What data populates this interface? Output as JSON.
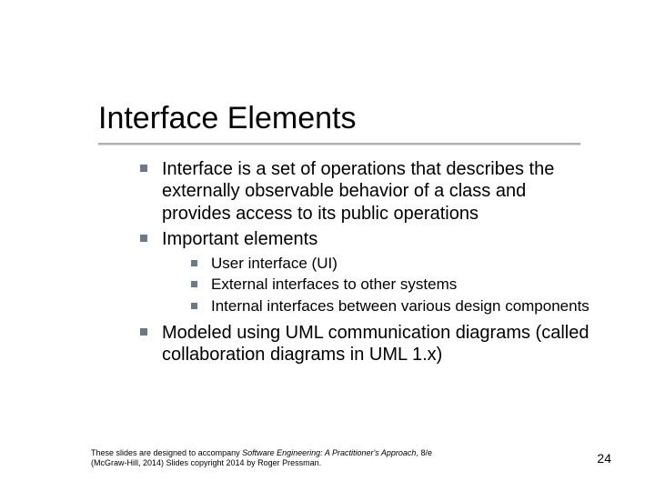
{
  "title": "Interface Elements",
  "bullets": {
    "b1": "Interface is a set of operations that describes the externally observable behavior of a class and provides access to its public operations",
    "b2": "Important elements",
    "b2_sub": {
      "s1": "User interface (UI)",
      "s2": "External interfaces to other systems",
      "s3": "Internal interfaces between various design components"
    },
    "b3": "Modeled using UML communication diagrams (called collaboration diagrams in UML 1.x)"
  },
  "footer": {
    "line1_prefix": "These slides are designed to accompany ",
    "line1_title": "Software Engineering: A Practitioner's Approach",
    "line1_suffix": ", 8/e",
    "line2": "(McGraw-Hill, 2014) Slides copyright 2014 by Roger Pressman."
  },
  "page_number": "24"
}
